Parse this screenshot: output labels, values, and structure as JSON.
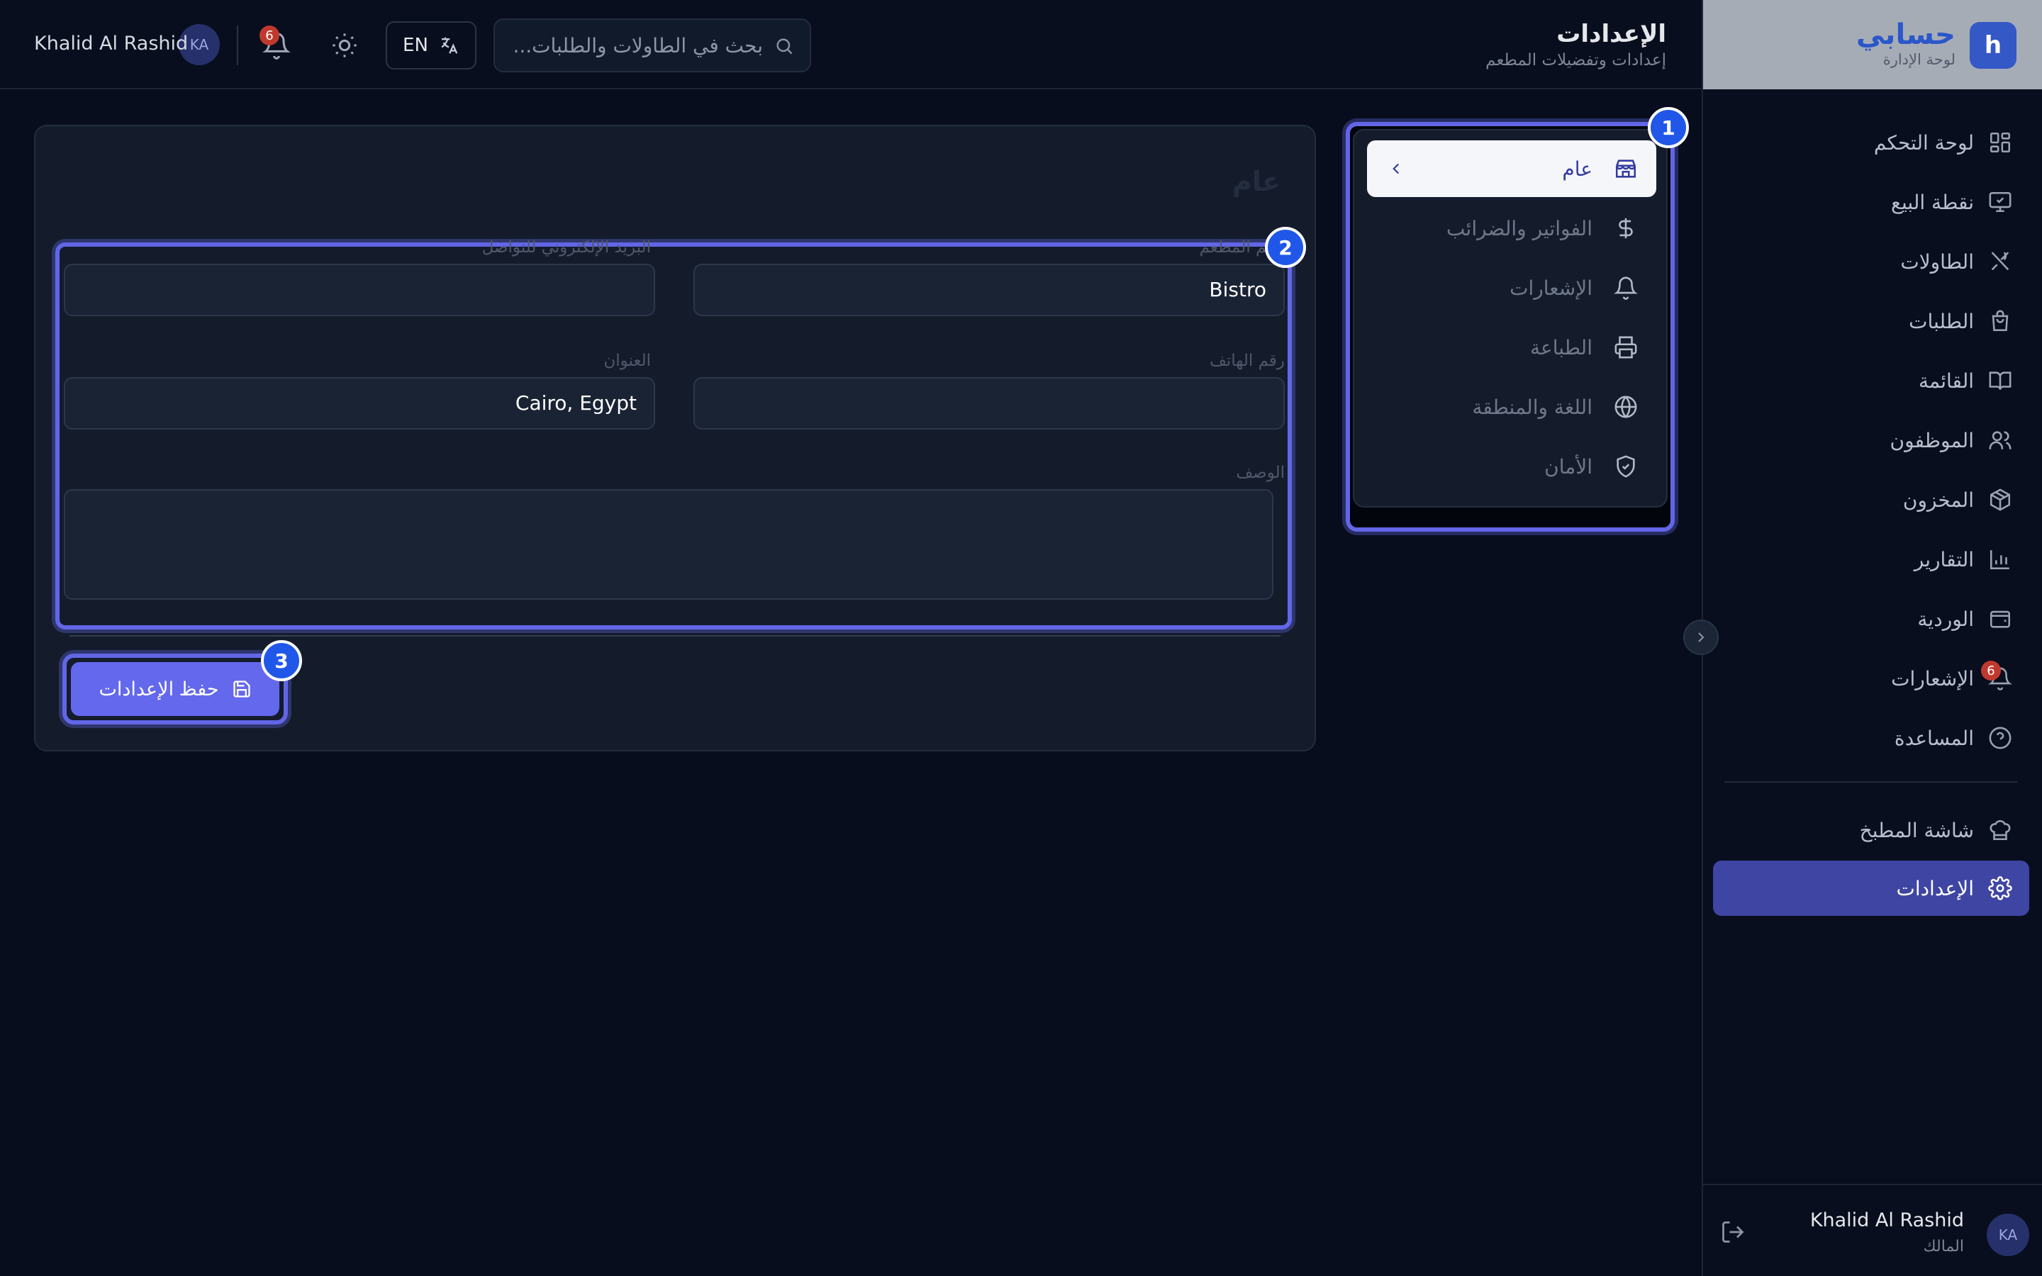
{
  "brand": {
    "logo_letter": "h",
    "name": "حسابي",
    "subtitle": "لوحة الإدارة"
  },
  "header": {
    "title": "الإعدادات",
    "subtitle": "إعدادات وتفضيلات المطعم",
    "search_placeholder": "بحث في الطاولات والطلبات...",
    "language_code": "EN",
    "notification_count": "6",
    "user_initials": "KA",
    "user_name": "Khalid Al Rashid"
  },
  "sidebar": {
    "items": [
      {
        "label": "لوحة التحكم",
        "icon": "dashboard-icon"
      },
      {
        "label": "نقطة البيع",
        "icon": "monitor-icon"
      },
      {
        "label": "الطاولات",
        "icon": "utensils-icon"
      },
      {
        "label": "الطلبات",
        "icon": "shopping-bag-icon"
      },
      {
        "label": "القائمة",
        "icon": "book-icon"
      },
      {
        "label": "الموظفون",
        "icon": "users-icon"
      },
      {
        "label": "المخزون",
        "icon": "package-icon"
      },
      {
        "label": "التقارير",
        "icon": "bar-chart-icon"
      },
      {
        "label": "الوردية",
        "icon": "wallet-icon"
      },
      {
        "label": "الإشعارات",
        "icon": "bell-icon",
        "badge": "6"
      },
      {
        "label": "المساعدة",
        "icon": "help-icon"
      }
    ],
    "secondary_items": [
      {
        "label": "شاشة المطبخ",
        "icon": "chef-hat-icon"
      },
      {
        "label": "الإعدادات",
        "icon": "gear-icon",
        "active": true
      }
    ],
    "footer": {
      "initials": "KA",
      "user_name": "Khalid Al Rashid",
      "role": "المالك"
    }
  },
  "settings_menu": {
    "items": [
      {
        "label": "عام",
        "icon": "store-icon",
        "active": true
      },
      {
        "label": "الفواتير والضرائب",
        "icon": "dollar-icon"
      },
      {
        "label": "الإشعارات",
        "icon": "bell-icon"
      },
      {
        "label": "الطباعة",
        "icon": "printer-icon"
      },
      {
        "label": "اللغة والمنطقة",
        "icon": "globe-icon"
      },
      {
        "label": "الأمان",
        "icon": "shield-icon"
      }
    ]
  },
  "general": {
    "title": "عام",
    "fields": {
      "restaurant_name": {
        "label": "اسم المطعم",
        "value": "Bistro"
      },
      "contact_email": {
        "label": "البريد الإلكتروني للتواصل",
        "value": ""
      },
      "phone": {
        "label": "رقم الهاتف",
        "value": ""
      },
      "address": {
        "label": "العنوان",
        "value": "Cairo, Egypt"
      },
      "description": {
        "label": "الوصف",
        "value": ""
      }
    },
    "save_label": "حفظ الإعدادات"
  },
  "markers": [
    "1",
    "2",
    "3"
  ],
  "colors": {
    "accent": "#6266e6",
    "marker": "#2057e8",
    "active_nav": "#3f45a3",
    "badge": "#c0392f",
    "brand": "#2a57c9"
  }
}
